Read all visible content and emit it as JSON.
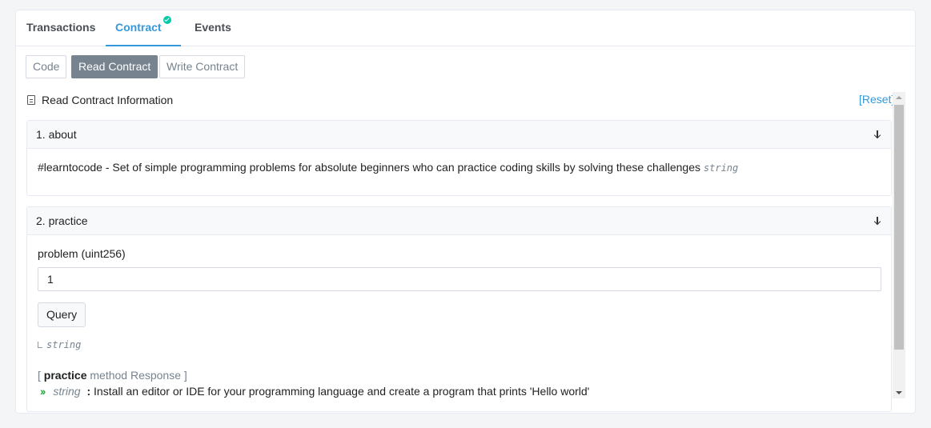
{
  "tabs": [
    {
      "label": "Transactions"
    },
    {
      "label": "Contract"
    },
    {
      "label": "Events"
    }
  ],
  "subtabs": [
    {
      "label": "Code"
    },
    {
      "label": "Read Contract"
    },
    {
      "label": "Write Contract"
    }
  ],
  "info": {
    "title": "Read Contract Information",
    "reset": "[Reset]"
  },
  "about": {
    "header": "1. about",
    "value": "#learntocode - Set of simple programming problems for absolute beginners who can practice coding skills by solving these challenges",
    "type": "string"
  },
  "practice": {
    "header": "2. practice",
    "input_label": "problem (uint256)",
    "input_value": "1",
    "query_label": "Query",
    "return_type": "string",
    "response_prefix": "[ ",
    "response_method": "practice",
    "response_suffix": " method Response ]",
    "response_type": "string",
    "response_colon": " : ",
    "response_value": "Install an editor or IDE for your programming language and create a program that prints 'Hello world'"
  }
}
